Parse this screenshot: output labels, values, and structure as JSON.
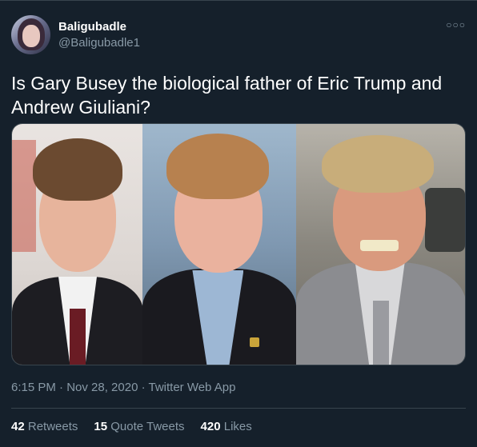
{
  "user": {
    "display_name": "Baligubadle",
    "handle": "@Baligubadle1"
  },
  "more_icon": "more-horizontal-icon",
  "tweet": {
    "text": "Is Gary Busey the biological father of Eric Trump and Andrew Giuliani?"
  },
  "meta": {
    "text": "6:15 PM · Nov 28, 2020 · Twitter Web App"
  },
  "stats": [
    {
      "count": "42",
      "label": "Retweets"
    },
    {
      "count": "15",
      "label": "Quote Tweets"
    },
    {
      "count": "420",
      "label": "Likes"
    }
  ],
  "colors": {
    "background": "#15202b",
    "secondary_text": "#8899a6",
    "border": "#38444d"
  }
}
